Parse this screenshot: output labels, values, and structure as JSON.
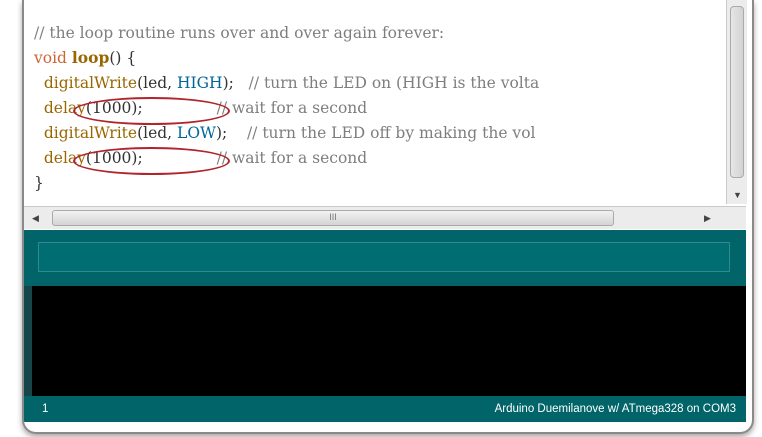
{
  "editor": {
    "lines": [
      {
        "parts": [
          {
            "t": "// the loop routine runs over and over again forever:",
            "k": "comment"
          }
        ]
      },
      {
        "parts": [
          {
            "t": "void ",
            "k": "type"
          },
          {
            "t": "loop",
            "k": "kw"
          },
          {
            "t": "() {",
            "k": "plain"
          }
        ]
      },
      {
        "parts": [
          {
            "t": "  ",
            "k": "plain"
          },
          {
            "t": "digitalWrite",
            "k": "fn"
          },
          {
            "t": "(led, ",
            "k": "plain"
          },
          {
            "t": "HIGH",
            "k": "const"
          },
          {
            "t": ");   ",
            "k": "plain"
          },
          {
            "t": "// turn the LED on (HIGH is the volta",
            "k": "comment"
          }
        ]
      },
      {
        "parts": [
          {
            "t": "  ",
            "k": "plain"
          },
          {
            "t": "delay",
            "k": "fn"
          },
          {
            "t": "(1000);",
            "k": "plain"
          },
          {
            "t": "               // wait for a second",
            "k": "comment"
          }
        ]
      },
      {
        "parts": [
          {
            "t": "  ",
            "k": "plain"
          },
          {
            "t": "digitalWrite",
            "k": "fn"
          },
          {
            "t": "(led, ",
            "k": "plain"
          },
          {
            "t": "LOW",
            "k": "const"
          },
          {
            "t": ");    ",
            "k": "plain"
          },
          {
            "t": "// turn the LED off by making the vol",
            "k": "comment"
          }
        ]
      },
      {
        "parts": [
          {
            "t": "  ",
            "k": "plain"
          },
          {
            "t": "delay",
            "k": "fn"
          },
          {
            "t": "(1000);",
            "k": "plain"
          },
          {
            "t": "               // wait for a second",
            "k": "comment"
          }
        ]
      },
      {
        "parts": [
          {
            "t": "}",
            "k": "plain"
          }
        ]
      }
    ],
    "annotation_color": "#b0242a"
  },
  "scrollbar": {
    "grip_label": "III"
  },
  "status": {
    "line_number": "1",
    "board": "Arduino Duemilanove w/ ATmega328 on COM3"
  },
  "colors": {
    "teal": "#006468",
    "console": "#000000"
  }
}
